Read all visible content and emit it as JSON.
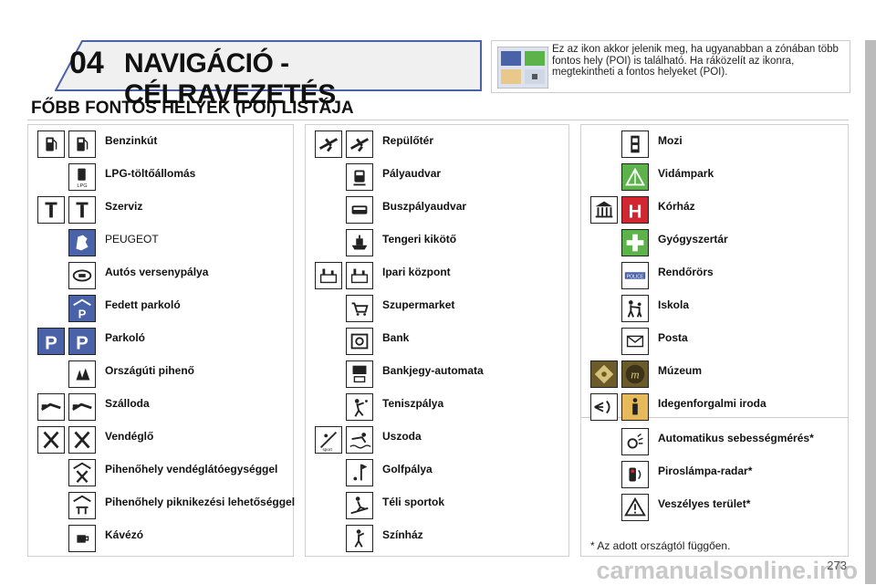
{
  "header": {
    "chapter": "04",
    "title": "NAVIGÁCIÓ - CÉLRAVEZETÉS"
  },
  "info": {
    "text": "Ez az ikon akkor jelenik meg, ha ugyanabban a zónában több fontos hely (POI) is található. Ha ráközelít az ikonra, megtekintheti a fontos helyeket (POI)."
  },
  "section_title": "FŐBB FONTOS HELYEK (POI) LISTÁJA",
  "col1": [
    {
      "label": "Benzinkút",
      "icons": [
        "fuel-icon",
        "fuel-icon"
      ]
    },
    {
      "label": "LPG-töltőállomás",
      "icons": [
        "lpg-icon"
      ]
    },
    {
      "label": "Szerviz",
      "icons": [
        "service-icon",
        "service-icon"
      ]
    },
    {
      "label": "PEUGEOT",
      "icons": [
        "peugeot-lion-icon"
      ]
    },
    {
      "label": "Autós versenypálya",
      "icons": [
        "race-track-icon"
      ]
    },
    {
      "label": "Fedett parkoló",
      "icons": [
        "covered-parking-icon"
      ]
    },
    {
      "label": "Parkoló",
      "icons": [
        "parking-icon",
        "parking-icon"
      ]
    },
    {
      "label": "Országúti pihenő",
      "icons": [
        "rest-area-icon"
      ]
    },
    {
      "label": "Szálloda",
      "icons": [
        "hotel-bed-icon",
        "hotel-bed-icon"
      ]
    },
    {
      "label": "Vendéglő",
      "icons": [
        "restaurant-icon",
        "restaurant-icon"
      ]
    },
    {
      "label": "Pihenőhely vendéglátóegységgel",
      "icons": [
        "rest-area-restaurant-icon"
      ]
    },
    {
      "label": "Pihenőhely piknikezési lehetőséggel",
      "icons": [
        "picnic-area-icon"
      ]
    },
    {
      "label": "Kávézó",
      "icons": [
        "cafe-icon"
      ]
    }
  ],
  "col2": [
    {
      "label": "Repülőtér",
      "icons": [
        "airport-icon",
        "airport-icon"
      ]
    },
    {
      "label": "Pályaudvar",
      "icons": [
        "train-station-icon"
      ]
    },
    {
      "label": "Buszpályaudvar",
      "icons": [
        "bus-station-icon"
      ]
    },
    {
      "label": "Tengeri kikötő",
      "icons": [
        "seaport-icon"
      ]
    },
    {
      "label": "Ipari központ",
      "icons": [
        "industrial-zone-icon",
        "industrial-zone-icon"
      ]
    },
    {
      "label": "Szupermarket",
      "icons": [
        "supermarket-icon"
      ]
    },
    {
      "label": "Bank",
      "icons": [
        "bank-icon"
      ]
    },
    {
      "label": "Bankjegy-automata",
      "icons": [
        "atm-icon"
      ]
    },
    {
      "label": "Teniszpálya",
      "icons": [
        "tennis-icon"
      ]
    },
    {
      "label": "Uszoda",
      "icons": [
        "sport-icon",
        "swimming-icon"
      ]
    },
    {
      "label": "Golfpálya",
      "icons": [
        "golf-icon"
      ]
    },
    {
      "label": "Téli sportok",
      "icons": [
        "winter-sports-icon"
      ]
    },
    {
      "label": "Színház",
      "icons": [
        "theatre-icon"
      ]
    }
  ],
  "col3": [
    {
      "label": "Mozi",
      "icons": [
        "cinema-icon"
      ]
    },
    {
      "label": "Vidámpark",
      "icons": [
        "amusement-park-icon"
      ]
    },
    {
      "label": "Kórház",
      "icons": [
        "hospital-building-icon",
        "hospital-cross-icon"
      ]
    },
    {
      "label": "Gyógyszertár",
      "icons": [
        "pharmacy-icon"
      ]
    },
    {
      "label": "Rendőrörs",
      "icons": [
        "police-icon"
      ]
    },
    {
      "label": "Iskola",
      "icons": [
        "school-icon"
      ]
    },
    {
      "label": "Posta",
      "icons": [
        "post-office-icon"
      ]
    },
    {
      "label": "Múzeum",
      "icons": [
        "museum-icon",
        "museum-icon-2"
      ]
    },
    {
      "label": "Idegenforgalmi iroda",
      "icons": [
        "tourist-info-icon",
        "info-icon"
      ]
    },
    {
      "label": "Automatikus sebességmérés*",
      "icons": [
        "speed-camera-icon"
      ]
    },
    {
      "label": "Piroslámpa-radar*",
      "icons": [
        "red-light-camera-icon"
      ]
    },
    {
      "label": "Veszélyes terület*",
      "icons": [
        "danger-zone-icon"
      ]
    }
  ],
  "footnote": "* Az adott országtól függően.",
  "page_number": "273",
  "watermark": "carmanualsonline.info",
  "colors": {
    "accent": "#4a63a8",
    "red": "#d22630",
    "green": "#5cb34a"
  }
}
